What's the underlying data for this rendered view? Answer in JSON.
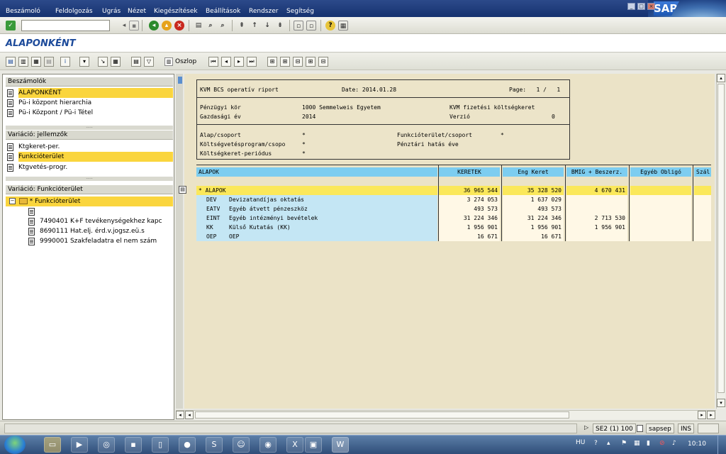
{
  "menu": [
    "Beszámoló",
    "Feldolgozás",
    "Ugrás",
    "Nézet",
    "Kiegészítések",
    "Beállítások",
    "Rendszer",
    "Segítség"
  ],
  "sap_logo": "SAP",
  "screen_title": "ALAPONKÉNT",
  "toolbar": {
    "column_button": "Oszlop"
  },
  "left": {
    "reports_header": "Beszámolók",
    "reports": [
      "ALAPONKÉNT",
      "Pü-i központ hierarchia",
      "Pü-i Központ / Pü-i Tétel"
    ],
    "variation1_header": "Variáció: jellemzők",
    "variation1": [
      "Ktgkeret-per.",
      "Funkcióterület",
      "Ktgvetés-progr."
    ],
    "variation2_header": "Variáció: Funkcióterület",
    "tree_root": "* Funkcióterület",
    "tree_items": [
      "",
      "7490401 K+F tevékenységekhez kapc",
      "8690111 Hat.elj. érd.v.jogsz.eü.s",
      "9990001 Szakfeladatra el nem szám"
    ]
  },
  "report_header": {
    "line1_title": "KVM BCS operatív riport",
    "line1_date": "Date: 2014.01.28",
    "line1_page": "Page:   1 /   1",
    "penzugyi_kor_label": "Pénzügyi kör",
    "penzugyi_kor_value": "1000 Semmelweis Egyetem",
    "kvm_label": "KVM fizetési költségkeret",
    "gazd_ev_label": "Gazdasági év",
    "gazd_ev_value": "2014",
    "verzio_label": "Verzió",
    "verzio_value": "0",
    "alap_label": "Alap/csoport",
    "alap_value": "*",
    "funkc_label": "Funkcióterület/csoport",
    "funkc_value": "*",
    "kvprog_label": "Költségvetésprogram/csopo",
    "kvprog_value": "*",
    "penztari_label": "Pénztári hatás éve",
    "kkper_label": "Költségkeret-periódus",
    "kkper_value": "*"
  },
  "table": {
    "headers": [
      "ALAPOK",
      "KERETEK",
      "Eng Keret",
      "BMIG + Beszerz.",
      "Egyéb Obligó",
      "Szál"
    ],
    "total": {
      "label": "* ALAPOK",
      "keretek": "36 965 544",
      "eng": "35 328 520",
      "bmig": "4 670 431"
    },
    "rows": [
      {
        "code": "DEV",
        "name": "Devizatandíjas oktatás",
        "keretek": "3 274 053",
        "eng": "1 637 029",
        "bmig": ""
      },
      {
        "code": "EATV",
        "name": "Egyéb átvett pénzeszköz",
        "keretek": "493 573",
        "eng": "493 573",
        "bmig": ""
      },
      {
        "code": "EINT",
        "name": "Egyéb intézményi bevételek",
        "keretek": "31 224 346",
        "eng": "31 224 346",
        "bmig": "2 713 530"
      },
      {
        "code": "KK",
        "name": "Külső Kutatás (KK)",
        "keretek": "1 956 901",
        "eng": "1 956 901",
        "bmig": "1 956 901"
      },
      {
        "code": "OEP",
        "name": "OEP",
        "keretek": "16 671",
        "eng": "16 671",
        "bmig": ""
      }
    ]
  },
  "status": {
    "session": "SE2 (1) 100",
    "server": "sapsep",
    "mode": "INS"
  },
  "taskbar": {
    "lang": "HU",
    "time": "10:10"
  },
  "colors": {
    "menubar": "#1f3c7a",
    "selection": "#fad53e",
    "table_header": "#7dcdf0",
    "row_blue": "#c4e6f4",
    "total_yellow": "#fbe85a",
    "report_bg": "#ebe3c7",
    "title_blue": "#1c4a9a"
  }
}
